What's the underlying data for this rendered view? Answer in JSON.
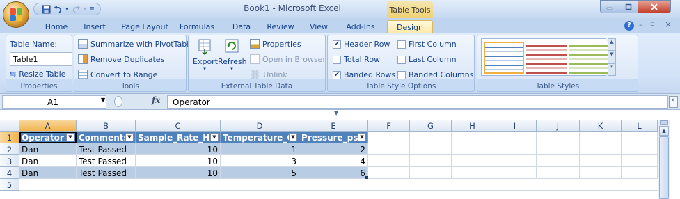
{
  "titlebar": {
    "window_title": "Book1 - Microsoft Excel",
    "context_tab_group": "Table Tools"
  },
  "tabs": [
    "Home",
    "Insert",
    "Page Layout",
    "Formulas",
    "Data",
    "Review",
    "View",
    "Add-Ins",
    "Design"
  ],
  "ribbon": {
    "properties": {
      "table_name_label": "Table Name:",
      "table_name_value": "Table1",
      "resize_label": "Resize Table",
      "group_label": "Properties"
    },
    "tools": {
      "summarize": "Summarize with PivotTable",
      "remove_dupes": "Remove Duplicates",
      "convert": "Convert to Range",
      "group_label": "Tools"
    },
    "external": {
      "export": "Export",
      "refresh": "Refresh",
      "properties": "Properties",
      "open_browser": "Open in Browser",
      "unlink": "Unlink",
      "group_label": "External Table Data"
    },
    "style_options": {
      "header_row": {
        "label": "Header Row",
        "checked": true
      },
      "total_row": {
        "label": "Total Row",
        "checked": false
      },
      "banded_rows": {
        "label": "Banded Rows",
        "checked": true
      },
      "first_column": {
        "label": "First Column",
        "checked": false
      },
      "last_column": {
        "label": "Last Column",
        "checked": false
      },
      "banded_columns": {
        "label": "Banded Columns",
        "checked": false
      },
      "group_label": "Table Style Options"
    },
    "table_styles": {
      "group_label": "Table Styles"
    }
  },
  "formula_bar": {
    "name_box": "A1",
    "fx": "fx",
    "content": "Operator"
  },
  "sheet": {
    "columns": [
      "A",
      "B",
      "C",
      "D",
      "E",
      "F",
      "G",
      "H",
      "I",
      "J",
      "K",
      "L"
    ],
    "rows": [
      "1",
      "2",
      "3",
      "4",
      "5"
    ],
    "table": {
      "headers": [
        "Operator",
        "Comments",
        "Sample_Rate_Hz",
        "Temperature_C",
        "Pressure_psi"
      ],
      "data": [
        [
          "Dan",
          "Test Passed",
          "10",
          "1",
          "2"
        ],
        [
          "Dan",
          "Test Passed",
          "10",
          "3",
          "4"
        ],
        [
          "Dan",
          "Test Passed",
          "10",
          "5",
          "6"
        ]
      ]
    }
  },
  "colors": {
    "table_header": "#4f81bd",
    "band": "#b8cce4",
    "ribbon": "#dbe8f8"
  }
}
